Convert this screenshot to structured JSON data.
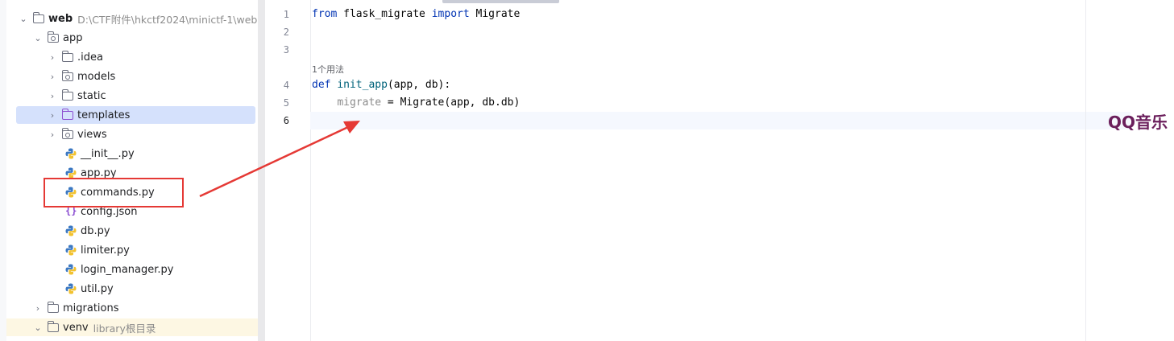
{
  "project_tree": {
    "root": {
      "name": "web",
      "path": "D:\\CTF附件\\hkctf2024\\minictf-1\\web"
    },
    "app_folder": "app",
    "items": [
      {
        "label": "app",
        "kind": "package-folder",
        "depth": 1,
        "expanded": true
      },
      {
        "label": ".idea",
        "kind": "folder",
        "depth": 2,
        "expanded": false
      },
      {
        "label": "models",
        "kind": "package-folder",
        "depth": 2,
        "expanded": false
      },
      {
        "label": "static",
        "kind": "folder",
        "depth": 2,
        "expanded": false
      },
      {
        "label": "templates",
        "kind": "templates-folder",
        "depth": 2,
        "expanded": false,
        "selected": true
      },
      {
        "label": "views",
        "kind": "package-folder",
        "depth": 2,
        "expanded": false
      },
      {
        "label": "__init__.py",
        "kind": "python-file",
        "depth": 3
      },
      {
        "label": "app.py",
        "kind": "python-file",
        "depth": 3
      },
      {
        "label": "commands.py",
        "kind": "python-file",
        "depth": 3,
        "highlighted": true
      },
      {
        "label": "config.json",
        "kind": "json-file",
        "depth": 3
      },
      {
        "label": "db.py",
        "kind": "python-file",
        "depth": 3
      },
      {
        "label": "limiter.py",
        "kind": "python-file",
        "depth": 3
      },
      {
        "label": "login_manager.py",
        "kind": "python-file",
        "depth": 3
      },
      {
        "label": "util.py",
        "kind": "python-file",
        "depth": 3
      },
      {
        "label": "migrations",
        "kind": "folder",
        "depth": 1,
        "expanded": false
      },
      {
        "label": "venv",
        "kind": "folder",
        "depth": 1,
        "expanded": true,
        "hint": "library根目录"
      }
    ]
  },
  "editor": {
    "line_numbers": [
      "1",
      "2",
      "3",
      "4",
      "5",
      "6"
    ],
    "usage_hint": "1个用法",
    "lines": {
      "l1": {
        "kw1": "from",
        "module": " flask_migrate ",
        "kw2": "import",
        "name": " Migrate"
      },
      "l4": {
        "kw": "def",
        "sp": " ",
        "fn": "init_app",
        "rest": "(app, db):"
      },
      "l5": {
        "indent": "    ",
        "var": "migrate",
        "rest": " = Migrate(app, db.db)"
      }
    },
    "current_line": 6
  },
  "watermark": "QQ音乐",
  "colors": {
    "keyword": "#0033b3",
    "function_name": "#00627a",
    "unused_variable": "#8c8c8c",
    "selection": "#d5e1fc",
    "annotation_red": "#e53935"
  },
  "icons": {
    "chevron_right": "chevron-right-icon",
    "chevron_down": "chevron-down-icon",
    "folder": "folder-icon",
    "python_file": "python-file-icon",
    "json_file": "json-file-icon"
  }
}
